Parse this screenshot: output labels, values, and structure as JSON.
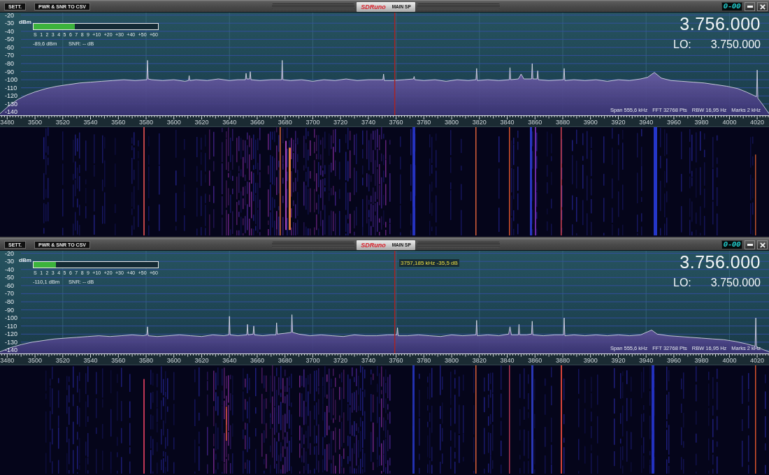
{
  "panels": [
    {
      "toolbar": {
        "settings_button": "SETT.",
        "export_button": "PWR & SNR TO CSV",
        "logo": "SDRuno",
        "title": "MAIN SP",
        "clock": "0-00"
      },
      "meter": {
        "unit": "dBm",
        "scale": [
          "S",
          "1",
          "2",
          "3",
          "4",
          "5",
          "6",
          "7",
          "8",
          "9",
          "+10",
          "+20",
          "+30",
          "+40",
          "+50",
          "+60"
        ],
        "level": 0.33,
        "power": "-89,6 dBm",
        "snr": "SNR: -- dB"
      },
      "frequency": "3.756.000",
      "lo": {
        "label": "LO:",
        "value": "3.750.000"
      },
      "info": [
        "Span 555,6 kHz",
        "FFT 32768 Pts",
        "RBW 16,95 Hz",
        "Marks 2 kHz"
      ],
      "chart_data": {
        "type": "area",
        "grid": true,
        "xlim": [
          3474.8,
          4028.5
        ],
        "ylim": [
          -144,
          -16
        ],
        "xticks": [
          3480,
          3500,
          3520,
          3540,
          3560,
          3580,
          3600,
          3620,
          3640,
          3660,
          3680,
          3700,
          3720,
          3740,
          3760,
          3780,
          3800,
          3820,
          3840,
          3860,
          3880,
          3900,
          3920,
          3940,
          3960,
          3980,
          4000,
          4020
        ],
        "yticks": [
          -20,
          -30,
          -40,
          -50,
          -60,
          -70,
          -80,
          -90,
          -100,
          -110,
          -120,
          -130,
          -140
        ],
        "ref_lines": [
          {
            "axis": "x",
            "value": 3759,
            "color": "#a82424"
          }
        ],
        "x": [
          3474.8,
          3482,
          3488,
          3494,
          3500,
          3508,
          3516,
          3524,
          3532,
          3540,
          3548,
          3556,
          3564,
          3572,
          3580.5,
          3581,
          3581.5,
          3584,
          3592,
          3600,
          3608,
          3610.5,
          3611,
          3611.5,
          3616,
          3624,
          3632,
          3640,
          3646,
          3651.5,
          3652,
          3652.5,
          3654.5,
          3655,
          3655.5,
          3662,
          3670,
          3677.5,
          3678,
          3678.5,
          3684,
          3692,
          3700,
          3708,
          3716,
          3724,
          3732,
          3740,
          3750.5,
          3751,
          3751.5,
          3758,
          3766,
          3772.5,
          3773,
          3773.5,
          3780,
          3788,
          3796,
          3804,
          3812,
          3817.5,
          3818,
          3818.5,
          3826,
          3834,
          3841.5,
          3842,
          3842.5,
          3848,
          3850,
          3852,
          3857.5,
          3858,
          3858.5,
          3861.5,
          3862,
          3862.5,
          3870,
          3880.5,
          3881,
          3881.5,
          3888,
          3896,
          3904,
          3912,
          3920,
          3928,
          3936,
          3941,
          3946,
          3951,
          3958,
          3966,
          3974,
          3982,
          3990,
          3998,
          4006,
          4012,
          4019.5,
          4020,
          4020.5,
          4024,
          4028.5
        ],
        "series": [
          {
            "color": "#7a6ab4",
            "values": [
              -142,
              -131,
              -124,
              -119,
              -115,
              -111,
              -108,
              -106,
              -104,
              -103,
              -102,
              -101,
              -100,
              -101,
              -100,
              -76,
              -99,
              -100,
              -101,
              -100,
              -102,
              -101,
              -95,
              -101,
              -100,
              -101,
              -99,
              -101,
              -100,
              -100,
              -92,
              -99,
              -99,
              -90,
              -100,
              -101,
              -100,
              -100,
              -76,
              -100,
              -101,
              -100,
              -102,
              -100,
              -101,
              -99,
              -101,
              -100,
              -100,
              -93,
              -101,
              -101,
              -100,
              -99,
              -96,
              -100,
              -101,
              -100,
              -102,
              -100,
              -101,
              -100,
              -86,
              -101,
              -100,
              -101,
              -100,
              -85,
              -100,
              -99,
              -93,
              -99,
              -99,
              -80,
              -99,
              -99,
              -89,
              -100,
              -101,
              -100,
              -86,
              -101,
              -100,
              -101,
              -100,
              -102,
              -100,
              -101,
              -99,
              -97,
              -91,
              -98,
              -101,
              -102,
              -103,
              -104,
              -106,
              -108,
              -111,
              -115,
              -121,
              -88,
              -123,
              -131,
              -142
            ]
          }
        ]
      }
    },
    {
      "toolbar": {
        "settings_button": "SETT.",
        "export_button": "PWR & SNR TO CSV",
        "logo": "SDRuno",
        "title": "MAIN SP",
        "clock": "0-00"
      },
      "meter": {
        "unit": "dBm",
        "scale": [
          "S",
          "1",
          "2",
          "3",
          "4",
          "5",
          "6",
          "7",
          "8",
          "9",
          "+10",
          "+20",
          "+30",
          "+40",
          "+50",
          "+60"
        ],
        "level": 0.18,
        "power": "-110,1 dBm",
        "snr": "SNR: -- dB"
      },
      "frequency": "3.756.000",
      "lo": {
        "label": "LO:",
        "value": "3.750.000"
      },
      "cursor_readout": "3757,185 kHz -35,5 dB",
      "info": [
        "Span 555,6 kHz",
        "FFT 32768 Pts",
        "RBW 16,95 Hz",
        "Marks 2 kHz"
      ],
      "chart_data": {
        "type": "area",
        "grid": true,
        "xlim": [
          3474.8,
          4028.5
        ],
        "ylim": [
          -144,
          -16
        ],
        "xticks": [
          3480,
          3500,
          3520,
          3540,
          3560,
          3580,
          3600,
          3620,
          3640,
          3660,
          3680,
          3700,
          3720,
          3740,
          3760,
          3780,
          3800,
          3820,
          3840,
          3860,
          3880,
          3900,
          3920,
          3940,
          3960,
          3980,
          4000,
          4020
        ],
        "yticks": [
          -20,
          -30,
          -40,
          -50,
          -60,
          -70,
          -80,
          -90,
          -100,
          -110,
          -120,
          -130,
          -140
        ],
        "ref_lines": [
          {
            "axis": "x",
            "value": 3759,
            "color": "#a82424"
          }
        ],
        "x": [
          3474.8,
          3482,
          3490,
          3498,
          3506,
          3514,
          3522,
          3530,
          3538,
          3546,
          3554,
          3562,
          3570,
          3578,
          3580.5,
          3581,
          3581.5,
          3588,
          3596,
          3604,
          3612,
          3620,
          3628,
          3636,
          3639.5,
          3640,
          3640.5,
          3646,
          3652.5,
          3653,
          3653.5,
          3657,
          3657.5,
          3658,
          3664,
          3670,
          3673.5,
          3674,
          3674.5,
          3680,
          3684.5,
          3685,
          3685.5,
          3690,
          3698,
          3706,
          3714,
          3722,
          3730,
          3738,
          3746,
          3754,
          3760.5,
          3761,
          3761.5,
          3768,
          3776,
          3784,
          3792,
          3800,
          3808,
          3817.5,
          3818,
          3818.5,
          3826,
          3834,
          3841,
          3842,
          3843,
          3848,
          3848.5,
          3849,
          3854,
          3857.5,
          3858,
          3858.5,
          3866,
          3874,
          3880.5,
          3881,
          3881.5,
          3888,
          3896,
          3904,
          3912,
          3920,
          3928,
          3936,
          3940,
          3944,
          3948,
          3956,
          3964,
          3972,
          3980,
          3988,
          3996,
          4004,
          4012,
          4018.5,
          4019,
          4019.5,
          4024,
          4028.5
        ],
        "series": [
          {
            "color": "#7a6ab4",
            "values": [
              -142,
              -137,
              -133,
              -130,
              -128,
              -126,
              -125,
              -124,
              -123,
              -122,
              -123,
              -122,
              -121,
              -122,
              -121,
              -111,
              -122,
              -123,
              -122,
              -121,
              -122,
              -123,
              -121,
              -122,
              -121,
              -98,
              -121,
              -122,
              -121,
              -108,
              -121,
              -120,
              -110,
              -121,
              -122,
              -121,
              -121,
              -106,
              -120,
              -119,
              -118,
              -96,
              -118,
              -120,
              -122,
              -121,
              -122,
              -123,
              -121,
              -122,
              -122,
              -121,
              -121,
              -112,
              -122,
              -122,
              -121,
              -122,
              -123,
              -121,
              -122,
              -121,
              -103,
              -122,
              -121,
              -122,
              -120,
              -111,
              -121,
              -121,
              -108,
              -121,
              -121,
              -120,
              -104,
              -121,
              -122,
              -121,
              -121,
              -100,
              -122,
              -121,
              -122,
              -121,
              -122,
              -121,
              -122,
              -121,
              -118,
              -115,
              -120,
              -122,
              -123,
              -124,
              -125,
              -126,
              -127,
              -129,
              -132,
              -135,
              -100,
              -136,
              -139,
              -142
            ]
          }
        ]
      }
    }
  ]
}
